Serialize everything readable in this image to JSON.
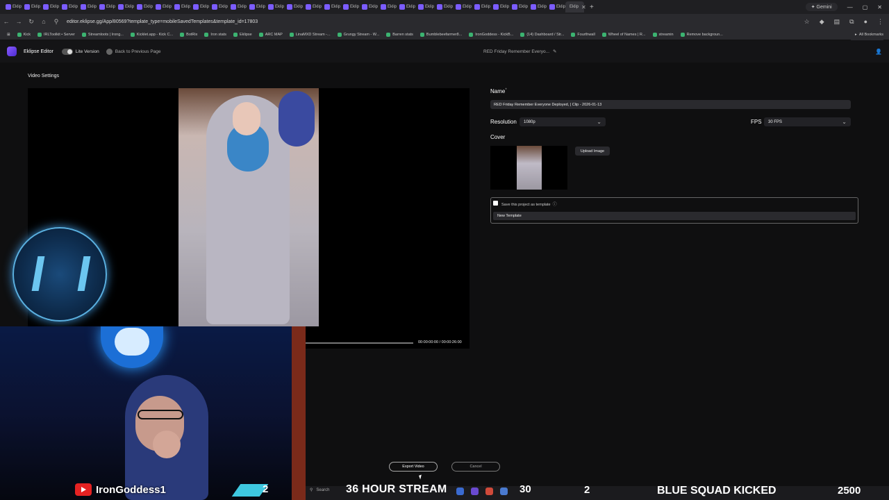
{
  "browser": {
    "tab_label": "Eklip",
    "tab_count": 31,
    "gemini_label": "Gemini",
    "url": "editor.eklipse.gg/App/80569?template_type=mobileSavedTemplates&template_id=17803",
    "bookmarks": [
      "Kick",
      "IRLToolkit • Server",
      "Streamloots | Irong...",
      "Kicklet.app - Kick C...",
      "BotRix",
      "Iron stats",
      "Eklipse",
      "ARC MAP",
      "LinaMXD Stream -...",
      "Grungy Stream - W...",
      "Barren stats",
      "Bumblebeefarmer8...",
      "IronGoddess - KickB...",
      "(14) Dashboard / Str...",
      "Fourthwall",
      "Wheel of Names | R...",
      "streamin",
      "Remove backgroun..."
    ],
    "all_bookmarks": "All Bookmarks"
  },
  "app": {
    "name": "Eklipse Editor",
    "lite_version": "Lite Version",
    "back_label": "Back to Previous Page",
    "project_title": "RED Friday Remember Everyo..."
  },
  "video_settings": {
    "title": "Video Settings",
    "timecode": "00:00:00:00 / 00:00:26:00"
  },
  "form": {
    "name_label": "Name",
    "name_required": "*",
    "name_value": "RED Friday  Remember Everyone Deployed,  | Clip - 2026-01-13",
    "resolution_label": "Resolution",
    "resolution_value": "1080p",
    "fps_label": "FPS",
    "fps_value": "30 FPS",
    "cover_label": "Cover",
    "upload_label": "Upload Image",
    "save_template_label": "Save this project as template",
    "template_name_value": "New Template"
  },
  "actions": {
    "export_label": "Export Video",
    "cancel_label": "Cancel"
  },
  "stream_overlay": {
    "youtube_name": "IronGoddess1",
    "count_a": "2",
    "stream_banner": "36 HOUR STREAM",
    "search_label": "Search",
    "count_30": "30",
    "count_b": "2",
    "kicked_banner": "BLUE SQUAD KICKED",
    "score": "2500"
  },
  "colors": {
    "accent": "#7b5cff",
    "background": "#0f0f10"
  }
}
